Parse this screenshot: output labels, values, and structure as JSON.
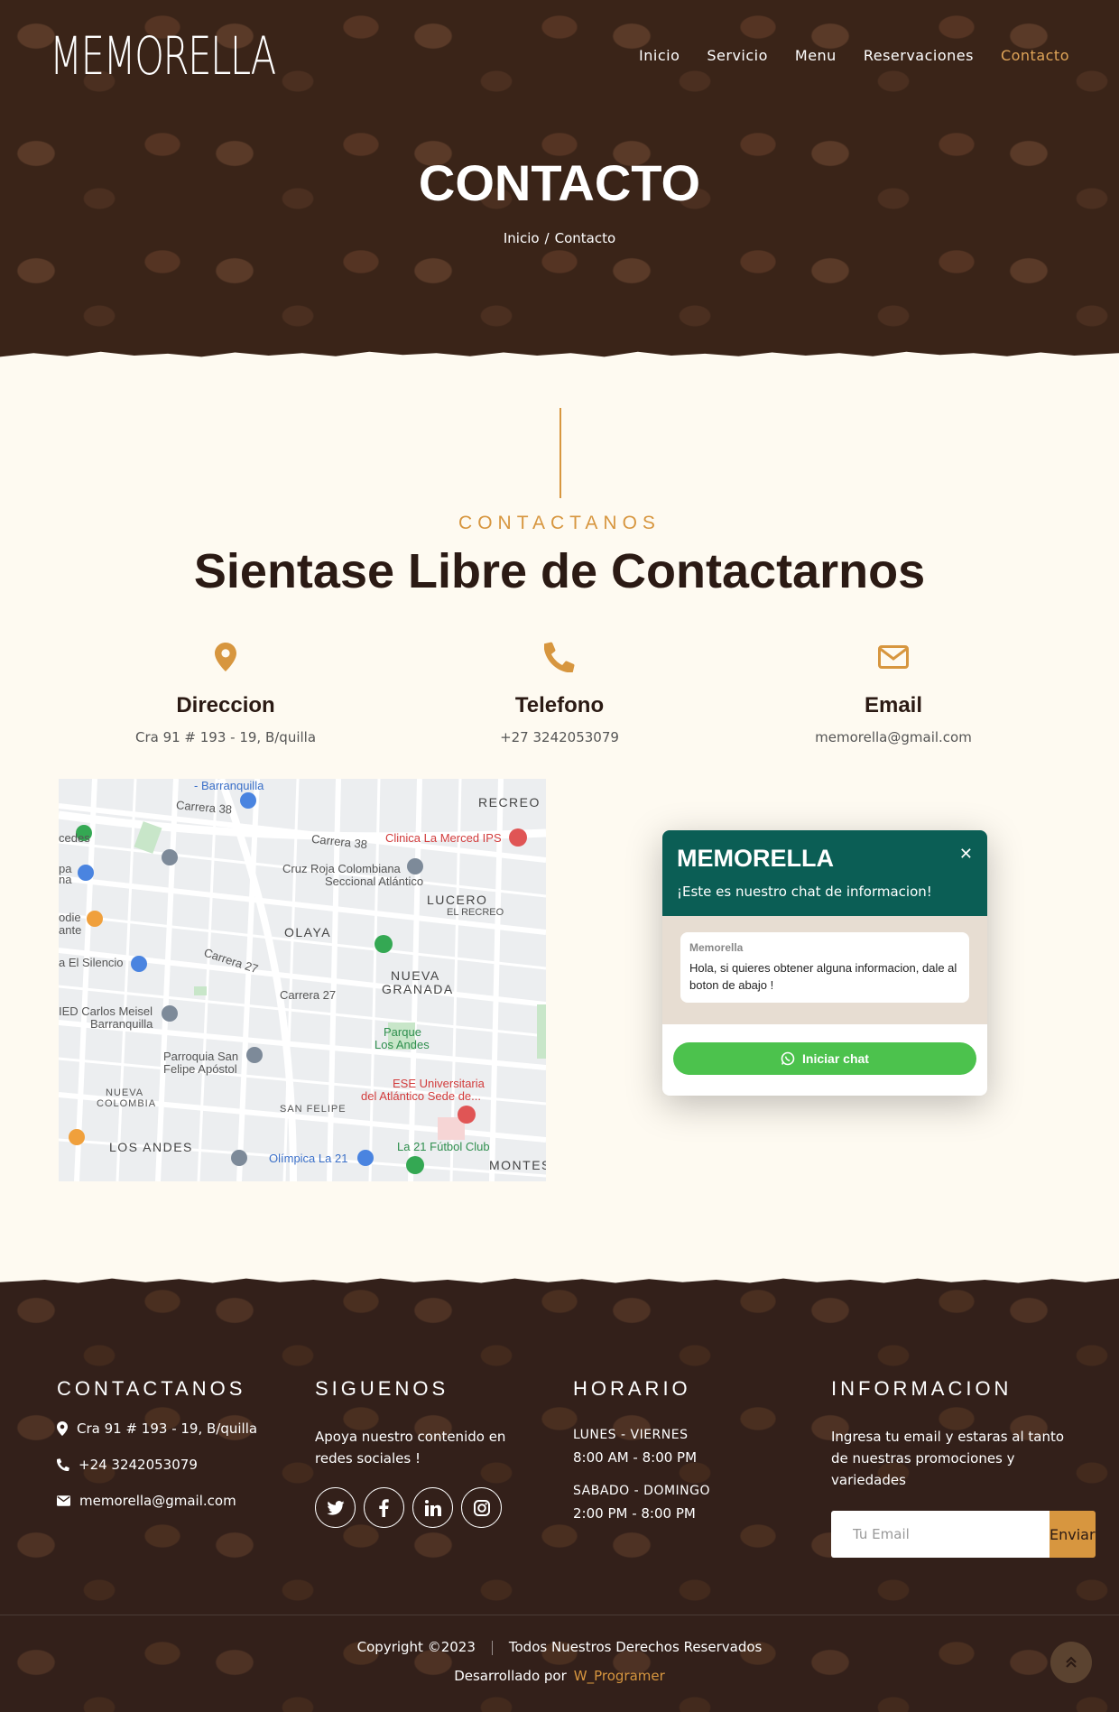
{
  "brand": {
    "logo_text": "MEMORELLA",
    "accent_color": "#d7963f",
    "dark_color": "#3a2418"
  },
  "nav": {
    "items": [
      "Inicio",
      "Servicio",
      "Menu",
      "Reservaciones",
      "Contacto"
    ],
    "active": "Contacto"
  },
  "hero": {
    "title": "CONTACTO",
    "breadcrumb_home": "Inicio",
    "breadcrumb_sep": "/",
    "breadcrumb_current": "Contacto"
  },
  "section": {
    "eyebrow": "CONTACTANOS",
    "title": "Sientase Libre de Contactarnos"
  },
  "info": [
    {
      "icon": "map-marker-icon",
      "title": "Direccion",
      "value": "Cra 91 # 193 - 19, B/quilla"
    },
    {
      "icon": "phone-icon",
      "title": "Telefono",
      "value": "+27 3242053079"
    },
    {
      "icon": "envelope-icon",
      "title": "Email",
      "value": "memorella@gmail.com"
    }
  ],
  "map": {
    "labels": {
      "barranquilla": "- Barranquilla",
      "carrera38": "Carrera 38",
      "recreo": "RECREO",
      "clinica": "Clinica La Merced IPS",
      "cruzroja1": "Cruz Roja Colombiana",
      "cruzroja2": "Seccional Atlántico",
      "lucero": "LUCERO",
      "elrecreo": "EL RECREO",
      "olaya": "OLAYA",
      "nueva": "NUEVA",
      "granada": "GRANADA",
      "silencio": "a El Silencio",
      "carlos1": "IED Carlos Meisel",
      "carlos2": "Barranquilla",
      "parque1": "Parque",
      "parque2": "Los Andes",
      "parroquia1": "Parroquia San",
      "parroquia2": "Felipe Apóstol",
      "ese1": "ESE Universitaria",
      "ese2": "del Atlántico Sede de...",
      "sanfelipe": "SAN FELIPE",
      "nuevacol1": "NUEVA",
      "nuevacol2": "COLOMBIA",
      "losandes": "LOS ANDES",
      "futbol": "La 21 Fútbol Club",
      "olimpica": "Olímpica La 21",
      "montes": "MONTES",
      "carrera27": "Carrera 27",
      "cedes": "cedes",
      "pa": "pa",
      "na": "na",
      "odie": "odie",
      "ante": "ante"
    }
  },
  "chat": {
    "title": "MEMORELLA",
    "subtitle": "¡Este es nuestro chat de informacion!",
    "sender": "Memorella",
    "message": "Hola, si quieres obtener alguna informacion, dale al boton de abajo !",
    "button": "Iniciar chat",
    "header_color": "#0b5e55",
    "button_color": "#4cc24d"
  },
  "footer": {
    "contact": {
      "heading": "CONTACTANOS",
      "address": "Cra 91 # 193 - 19, B/quilla",
      "phone": "+24 3242053079",
      "email": "memorella@gmail.com"
    },
    "follow": {
      "heading": "SIGUENOS",
      "text": "Apoya nuestro contenido en redes sociales !",
      "networks": [
        "twitter-icon",
        "facebook-icon",
        "linkedin-icon",
        "instagram-icon"
      ]
    },
    "hours": {
      "heading": "HORARIO",
      "day1": "LUNES - VIERNES",
      "time1": "8:00 AM - 8:00 PM",
      "day2": "SABADO - DOMINGO",
      "time2": "2:00 PM - 8:00 PM"
    },
    "newsletter": {
      "heading": "INFORMACION",
      "text": "Ingresa tu email y estaras al tanto de nuestras promociones y variedades",
      "placeholder": "Tu Email",
      "button": "Enviar"
    },
    "copyright": "Copyright ©2023",
    "rights": "Todos Nuestros Derechos Reservados",
    "developed_by": "Desarrollado por",
    "developer": "W_Programer"
  }
}
